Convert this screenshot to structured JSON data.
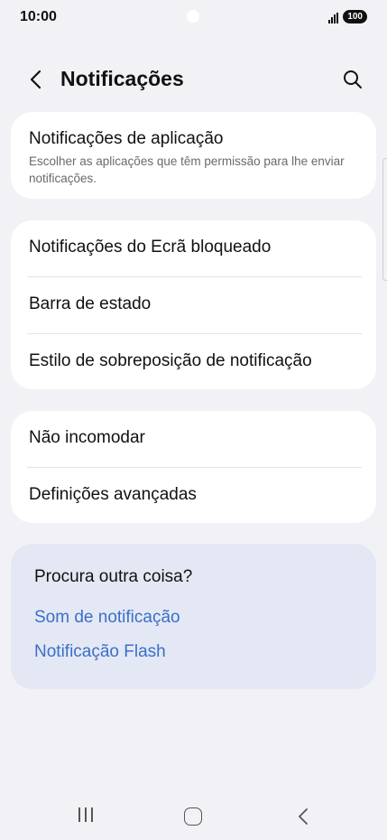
{
  "status_bar": {
    "time": "10:00",
    "battery": "100"
  },
  "header": {
    "title": "Notificações",
    "back_icon": "chevron-left-icon",
    "search_icon": "search-icon"
  },
  "app_notifications": {
    "title": "Notificações de aplicação",
    "subtitle": "Escolher as aplicações que têm permissão para lhe enviar notificações."
  },
  "group_display": {
    "items": [
      {
        "label": "Notificações do Ecrã bloqueado"
      },
      {
        "label": "Barra de estado"
      },
      {
        "label": "Estilo de sobreposição de notificação"
      }
    ]
  },
  "group_more": {
    "items": [
      {
        "label": "Não incomodar"
      },
      {
        "label": "Definições avançadas"
      }
    ]
  },
  "related": {
    "heading": "Procura outra coisa?",
    "links": [
      {
        "label": "Som de notificação"
      },
      {
        "label": "Notificação Flash"
      }
    ]
  },
  "colors": {
    "background": "#f2f2f6",
    "card": "#ffffff",
    "related_card": "#e4e8f4",
    "link": "#3a6fc8"
  }
}
